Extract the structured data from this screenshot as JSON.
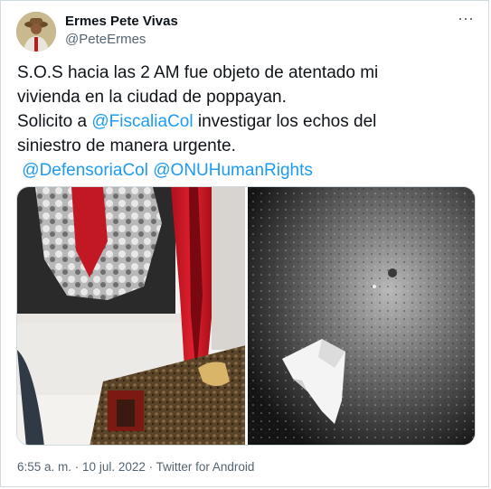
{
  "author": {
    "display_name": "Ermes Pete Vivas",
    "handle": "@PeteErmes"
  },
  "menu": {
    "more_icon_glyph": "···"
  },
  "tweet": {
    "line1": "S.O.S hacia las 2 AM fue objeto de atentado mi",
    "line2": "vivienda en la ciudad de poppayan.",
    "line3_prefix": "Solicito a ",
    "mention1": "@FiscaliaCol",
    "line3_suffix": " investigar los echos del",
    "line4": "siniestro de manera urgente.",
    "mention2": "@DefensoriaCol",
    "mention3": "@ONUHumanRights"
  },
  "meta": {
    "time": "6:55 a. m.",
    "sep1": " · ",
    "date": "10 jul. 2022",
    "sep2": " · ",
    "source": "Twitter for Android"
  },
  "colors": {
    "link": "#1d9bf0",
    "text": "#0f1419",
    "secondary": "#536471",
    "border": "#cfd9de"
  }
}
